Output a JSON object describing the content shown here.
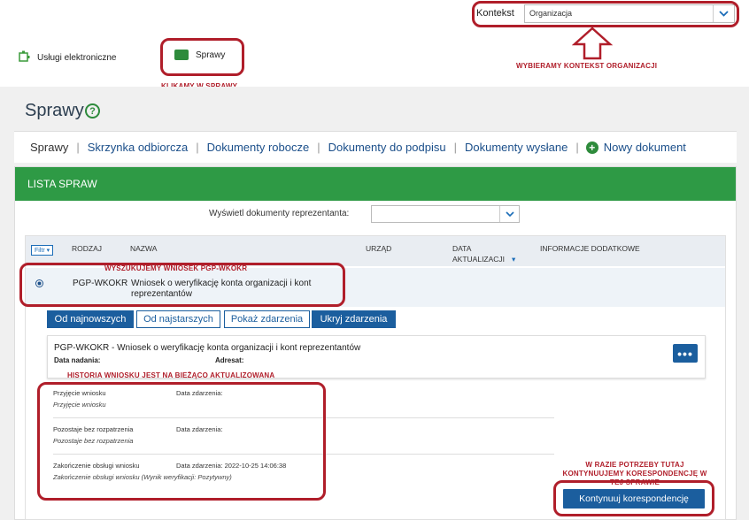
{
  "header": {
    "context_label": "Kontekst",
    "context_value": "Organizacja",
    "nav_items": [
      {
        "label": "Usługi elektroniczne"
      },
      {
        "label": "Sprawy"
      }
    ]
  },
  "annotations": {
    "context": "WYBIERAMY KONTEKST ORGANIZACJI",
    "sprawy": "KLIKAMY W SPRAWY",
    "search": "WYSZUKUJEMY WNIOSEK PGP-WKOKR",
    "history": "HISTORIA WNIOSKU JEST NA BIEŻĄCO AKTUALIZOWANA",
    "continue": "W RAZIE POTRZEBY TUTAJ KONTYNUUJEMY KORESPONDENCJĘ W TEJ SPRAWIE"
  },
  "page": {
    "title": "Sprawy",
    "help_icon": "?"
  },
  "tabs": {
    "items": [
      {
        "label": "Sprawy"
      },
      {
        "label": "Skrzynka odbiorcza"
      },
      {
        "label": "Dokumenty robocze"
      },
      {
        "label": "Dokumenty do podpisu"
      },
      {
        "label": "Dokumenty wysłane"
      }
    ],
    "new_document": "Nowy dokument"
  },
  "panel": {
    "header": "LISTA SPRAW",
    "representative_label": "Wyświetl dokumenty reprezentanta:",
    "representative_value": ""
  },
  "table": {
    "filter_label": "Filtr",
    "columns": {
      "rodzaj": "RODZAJ",
      "nazwa": "NAZWA",
      "urzad": "URZĄD",
      "data_line1": "DATA",
      "data_line2": "AKTUALIZACJI",
      "info": "INFORMACJE DODATKOWE"
    },
    "row": {
      "code": "PGP-WKOKR",
      "name": "Wniosek o weryfikację konta organizacji i kont reprezentantów"
    }
  },
  "sort_buttons": [
    {
      "label": "Od najnowszych",
      "active": true
    },
    {
      "label": "Od najstarszych",
      "active": false
    },
    {
      "label": "Pokaż zdarzenia",
      "active": false
    },
    {
      "label": "Ukryj zdarzenia",
      "active": true
    }
  ],
  "detail": {
    "title": "PGP-WKOKR - Wniosek o weryfikację konta organizacji i kont reprezentantów",
    "date_label": "Data nadania:",
    "addressee_label": "Adresat:",
    "menu_icon": "•••"
  },
  "events": [
    {
      "title": "Przyjęcie wniosku",
      "subtitle": "Przyjęcie wniosku",
      "date": "Data zdarzenia:"
    },
    {
      "title": "Pozostaje bez rozpatrzenia",
      "subtitle": "Pozostaje bez rozpatrzenia",
      "date": "Data zdarzenia:"
    },
    {
      "title": "Zakończenie obsługi wniosku",
      "subtitle": "Zakończenie obsługi wniosku (Wynik weryfikacji: Pozytywny)",
      "date": "Data zdarzenia: 2022-10-25 14:06:38"
    }
  ],
  "continue_button": "Kontynuuj korespondencję",
  "colors": {
    "accent_green": "#2e9a45",
    "primary_blue": "#1b5e9e",
    "annotation_red": "#b01e2a"
  }
}
